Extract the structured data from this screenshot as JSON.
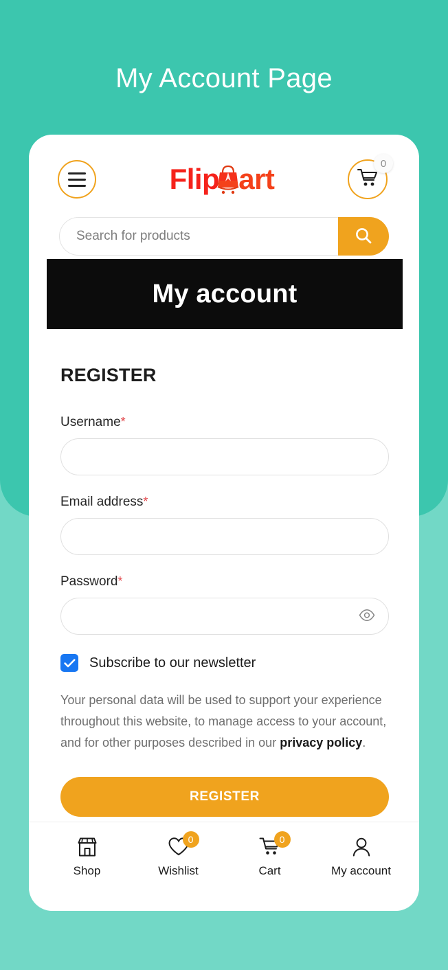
{
  "page": {
    "title": "My Account Page",
    "background_color": "#3cc6ae",
    "background_light_color": "#72d8c6"
  },
  "header": {
    "menu_icon": "hamburger-menu-icon",
    "logo": {
      "part_one": "Flip",
      "part_two": "art",
      "mark_icon": "shopping-bag-icon",
      "color_primary": "#f5221b",
      "color_secondary": "#f4411a"
    },
    "cart": {
      "icon": "shopping-cart-icon",
      "badge_count": "0"
    }
  },
  "search": {
    "placeholder": "Search for products",
    "value": "",
    "button_icon": "search-icon",
    "button_color": "#f0a31e"
  },
  "banner": {
    "title": "My account",
    "background_color": "#0c0c0c"
  },
  "form": {
    "heading": "REGISTER",
    "required_marker": "*",
    "fields": [
      {
        "label": "Username",
        "value": "",
        "placeholder": "",
        "required": true,
        "type": "text"
      },
      {
        "label": "Email address",
        "value": "",
        "placeholder": "",
        "required": true,
        "type": "email"
      },
      {
        "label": "Password",
        "value": "",
        "placeholder": "",
        "required": true,
        "type": "password"
      }
    ],
    "password_toggle_icon": "eye-icon",
    "newsletter": {
      "label": "Subscribe to our newsletter",
      "checked": true,
      "checkbox_color": "#1877f2"
    },
    "privacy_notice": {
      "text_before": "Your personal data will be used to support your experience throughout this website, to manage access to your account, and for other purposes described in our ",
      "link_text": "privacy policy",
      "text_after": "."
    },
    "submit_label": "REGISTER",
    "submit_color": "#f0a31e"
  },
  "bottom_nav": {
    "items": [
      {
        "label": "Shop",
        "icon": "storefront-icon",
        "badge": ""
      },
      {
        "label": "Wishlist",
        "icon": "heart-icon",
        "badge": "0"
      },
      {
        "label": "Cart",
        "icon": "shopping-cart-icon",
        "badge": "0"
      },
      {
        "label": "My account",
        "icon": "user-icon",
        "badge": ""
      }
    ],
    "badge_color": "#f0a31e"
  }
}
